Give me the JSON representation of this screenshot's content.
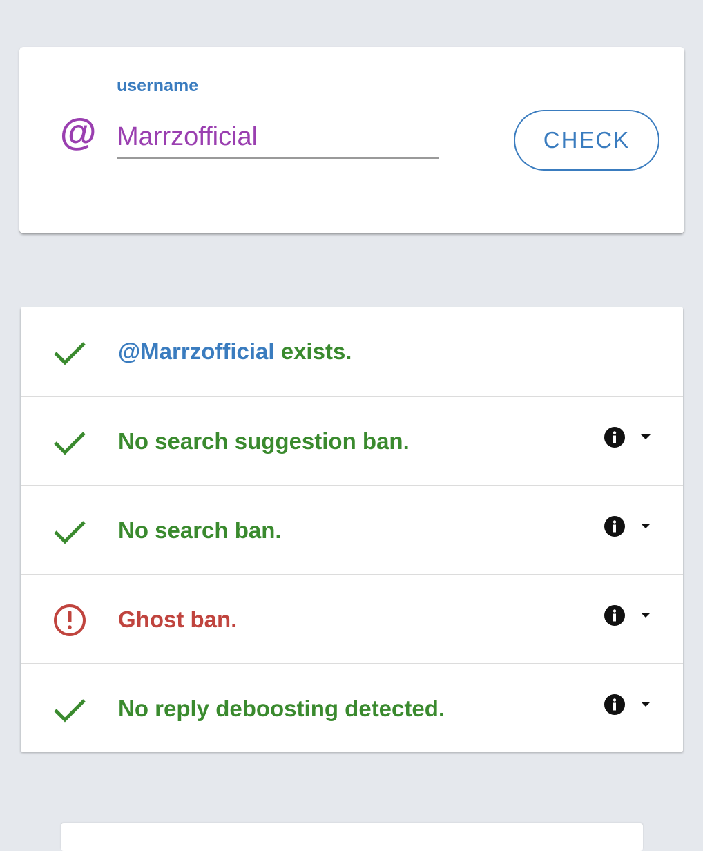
{
  "colors": {
    "background": "#e5e8ed",
    "purple": "#9a3fb0",
    "blue": "#3a7cbf",
    "green": "#3a8a2e",
    "red": "#c0443e",
    "black": "#111111"
  },
  "search": {
    "label": "username",
    "at_symbol": "@",
    "value": "Marrzofficial",
    "button_label": "CHECK"
  },
  "results": [
    {
      "icon": "checkmark-icon",
      "status": "ok",
      "handle": "@Marrzofficial",
      "text": " exists.",
      "has_info": false
    },
    {
      "icon": "checkmark-icon",
      "status": "ok",
      "text": "No search suggestion ban.",
      "has_info": true
    },
    {
      "icon": "checkmark-icon",
      "status": "ok",
      "text": "No search ban.",
      "has_info": true
    },
    {
      "icon": "alert-circle-icon",
      "status": "ban",
      "text": "Ghost ban.",
      "has_info": true
    },
    {
      "icon": "checkmark-icon",
      "status": "ok",
      "text": "No reply deboosting detected.",
      "has_info": true
    }
  ]
}
